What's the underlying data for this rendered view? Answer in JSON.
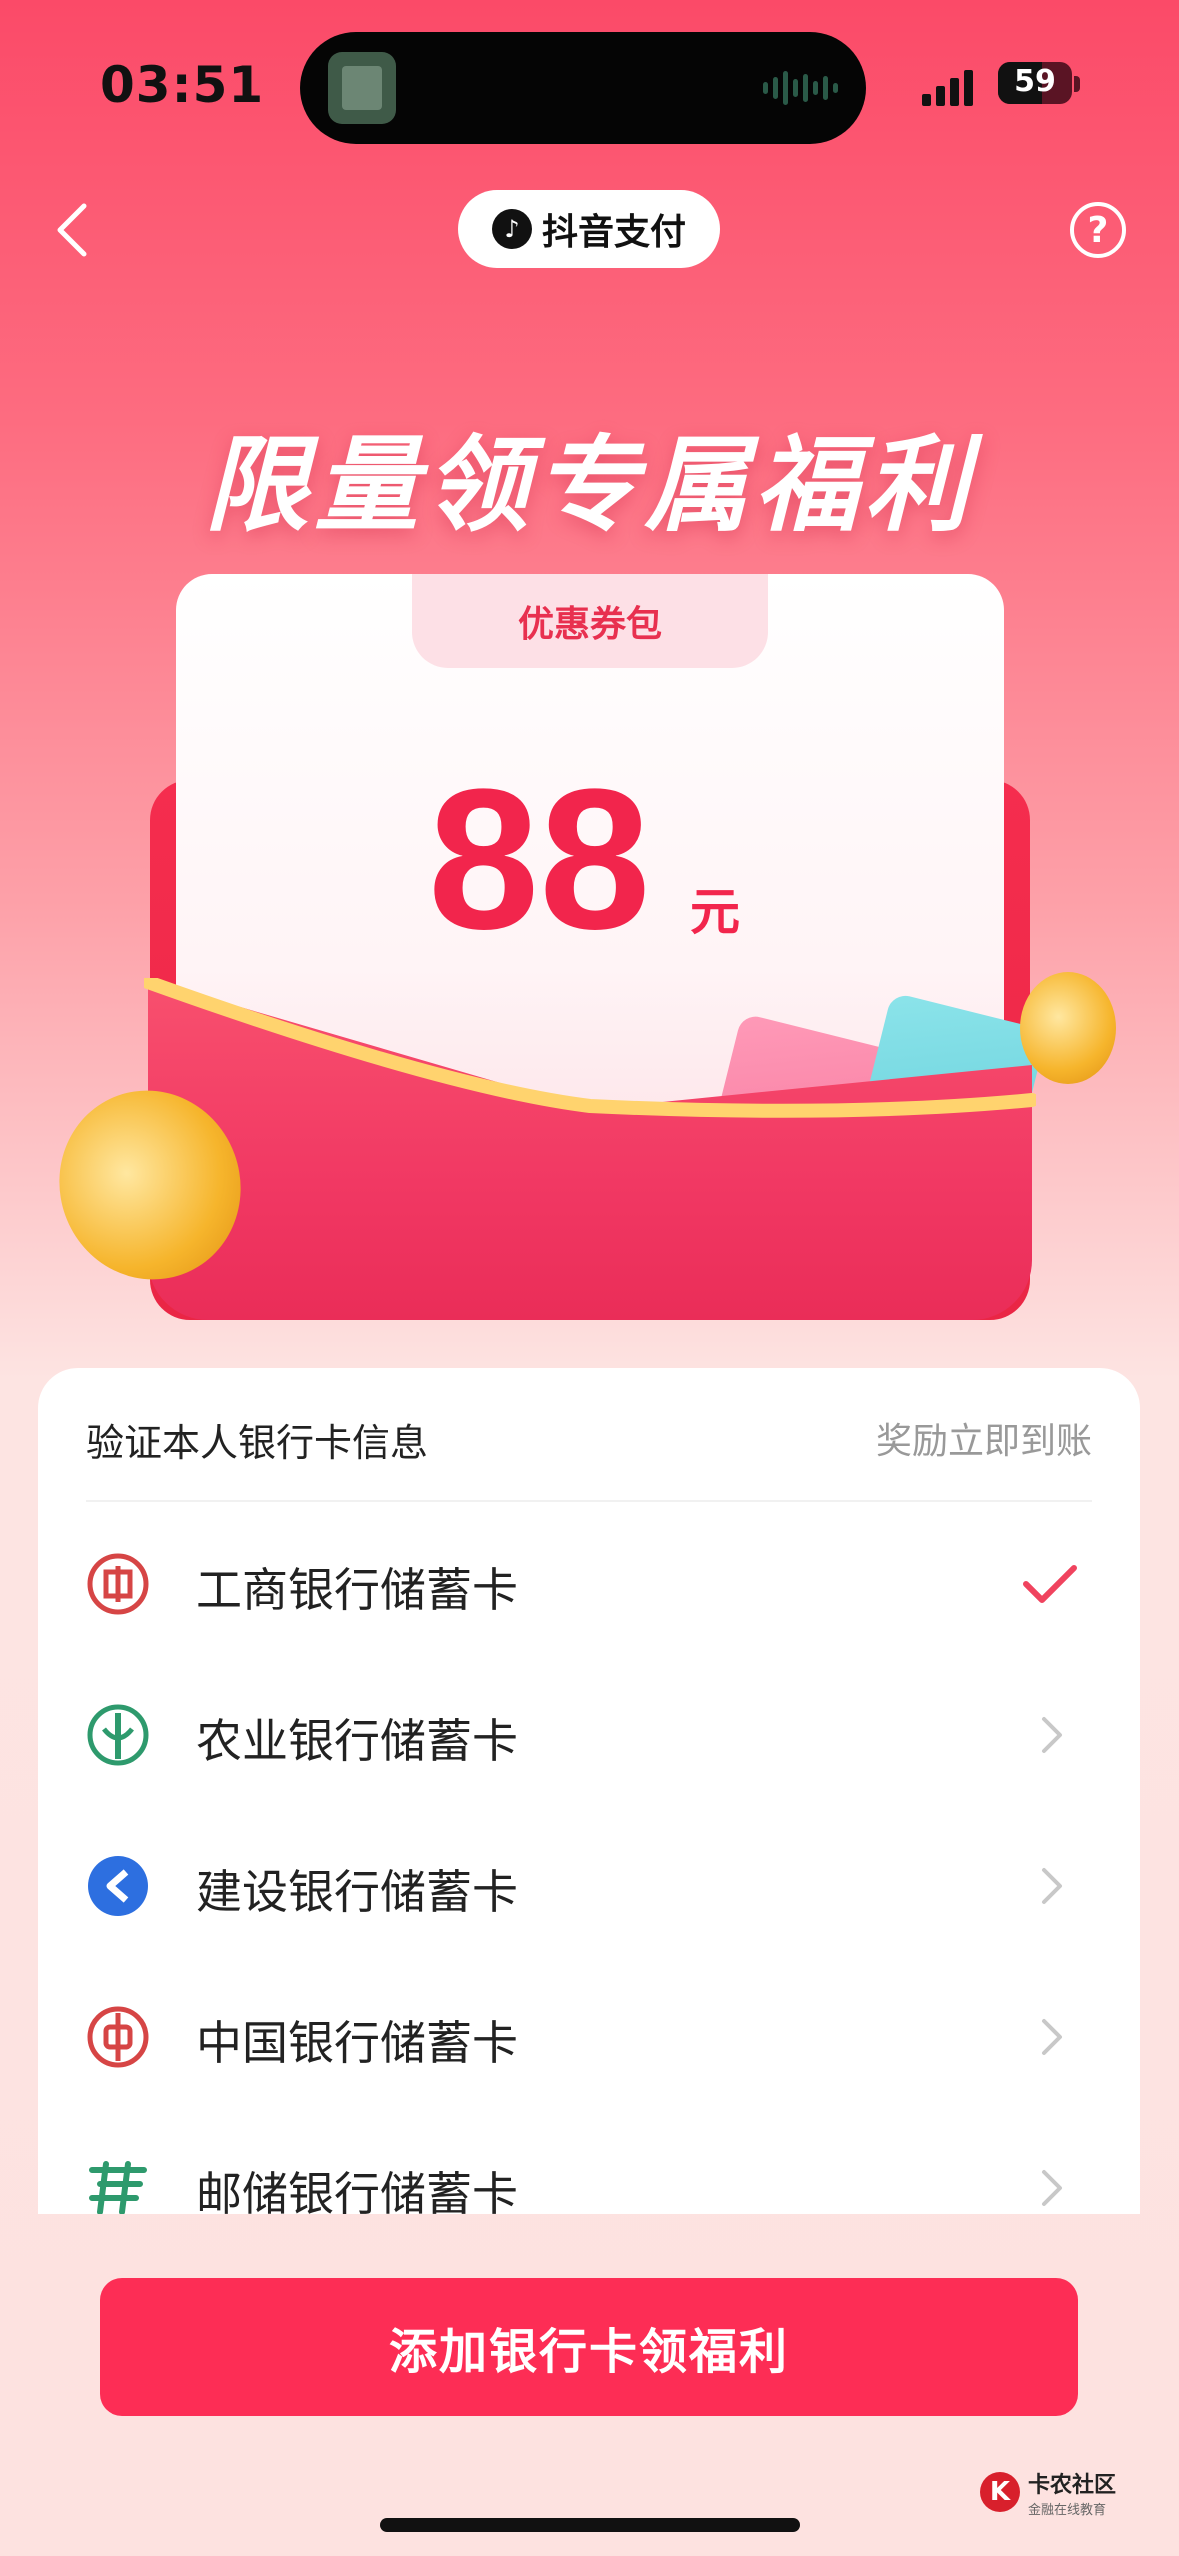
{
  "status_bar": {
    "time": "03:51",
    "battery": "59"
  },
  "header": {
    "brand": "抖音支付"
  },
  "hero": {
    "title": "限量领专属福利"
  },
  "voucher": {
    "tab_label": "优惠券包",
    "amount": "88",
    "unit": "元"
  },
  "panel": {
    "title": "验证本人银行卡信息",
    "note": "奖励立即到账",
    "banks": [
      {
        "name": "工商银行储蓄卡",
        "icon": "icbc-icon",
        "color": "#d64545",
        "state": "selected"
      },
      {
        "name": "农业银行储蓄卡",
        "icon": "abc-icon",
        "color": "#2e9a6d",
        "state": "chevron"
      },
      {
        "name": "建设银行储蓄卡",
        "icon": "ccb-icon",
        "color": "#2d6fe0",
        "state": "chevron"
      },
      {
        "name": "中国银行储蓄卡",
        "icon": "boc-icon",
        "color": "#d64545",
        "state": "chevron"
      },
      {
        "name": "邮储银行储蓄卡",
        "icon": "psbc-icon",
        "color": "#2e9a6d",
        "state": "chevron"
      }
    ]
  },
  "cta": {
    "label": "添加银行卡领福利"
  },
  "watermark": {
    "title": "卡农社区",
    "subtitle": "金融在线教育"
  },
  "colors": {
    "accent": "#fd2d55",
    "check": "#f0435e"
  }
}
